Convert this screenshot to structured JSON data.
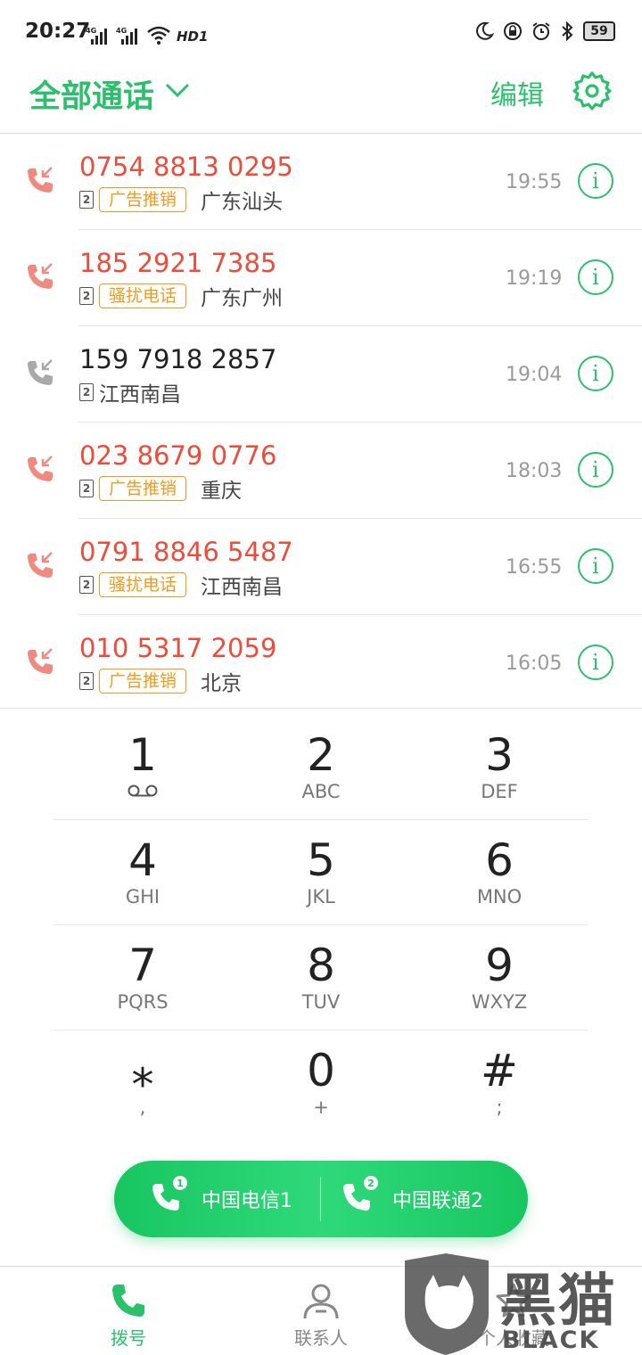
{
  "status_bar": {
    "time": "20:27",
    "signal1_tag": "4G",
    "signal2_tag": "4G",
    "hd_tag": "HD1",
    "battery": "59"
  },
  "header": {
    "title": "全部通话",
    "edit_label": "编辑"
  },
  "calls": [
    {
      "number": "0754 8813 0295",
      "tag": "广告推销",
      "location": "广东汕头",
      "time": "19:55",
      "sim": "2"
    },
    {
      "number": "185 2921 7385",
      "tag": "骚扰电话",
      "location": "广东广州",
      "time": "19:19",
      "sim": "2"
    },
    {
      "number": "159 7918 2857",
      "tag": "",
      "location": "江西南昌",
      "time": "19:04",
      "sim": "2"
    },
    {
      "number": "023 8679 0776",
      "tag": "广告推销",
      "location": "重庆",
      "time": "18:03",
      "sim": "2"
    },
    {
      "number": "0791 8846 5487",
      "tag": "骚扰电话",
      "location": "江西南昌",
      "time": "16:55",
      "sim": "2"
    },
    {
      "number": "010 5317 2059",
      "tag": "广告推销",
      "location": "北京",
      "time": "16:05",
      "sim": "2"
    }
  ],
  "info_glyph": "i",
  "dialpad": {
    "keys": [
      {
        "digit": "1",
        "letters": ""
      },
      {
        "digit": "2",
        "letters": "ABC"
      },
      {
        "digit": "3",
        "letters": "DEF"
      },
      {
        "digit": "4",
        "letters": "GHI"
      },
      {
        "digit": "5",
        "letters": "JKL"
      },
      {
        "digit": "6",
        "letters": "MNO"
      },
      {
        "digit": "7",
        "letters": "PQRS"
      },
      {
        "digit": "8",
        "letters": "TUV"
      },
      {
        "digit": "9",
        "letters": "WXYZ"
      },
      {
        "digit": "⁎",
        "letters": ","
      },
      {
        "digit": "0",
        "letters": "+"
      },
      {
        "digit": "#",
        "letters": ";"
      }
    ]
  },
  "sim_buttons": {
    "sim1_label": "中国电信1",
    "sim1_badge": "1",
    "sim2_label": "中国联通2",
    "sim2_badge": "2"
  },
  "bottom_nav": {
    "dial": "拨号",
    "contacts": "联系人",
    "favorites": "个人收藏"
  },
  "watermark": {
    "text": "黑猫",
    "sub": "BLACK CAT"
  },
  "colors": {
    "accent": "#2bc06b",
    "missed": "#ee4b3a",
    "tag": "#f39a1e"
  }
}
